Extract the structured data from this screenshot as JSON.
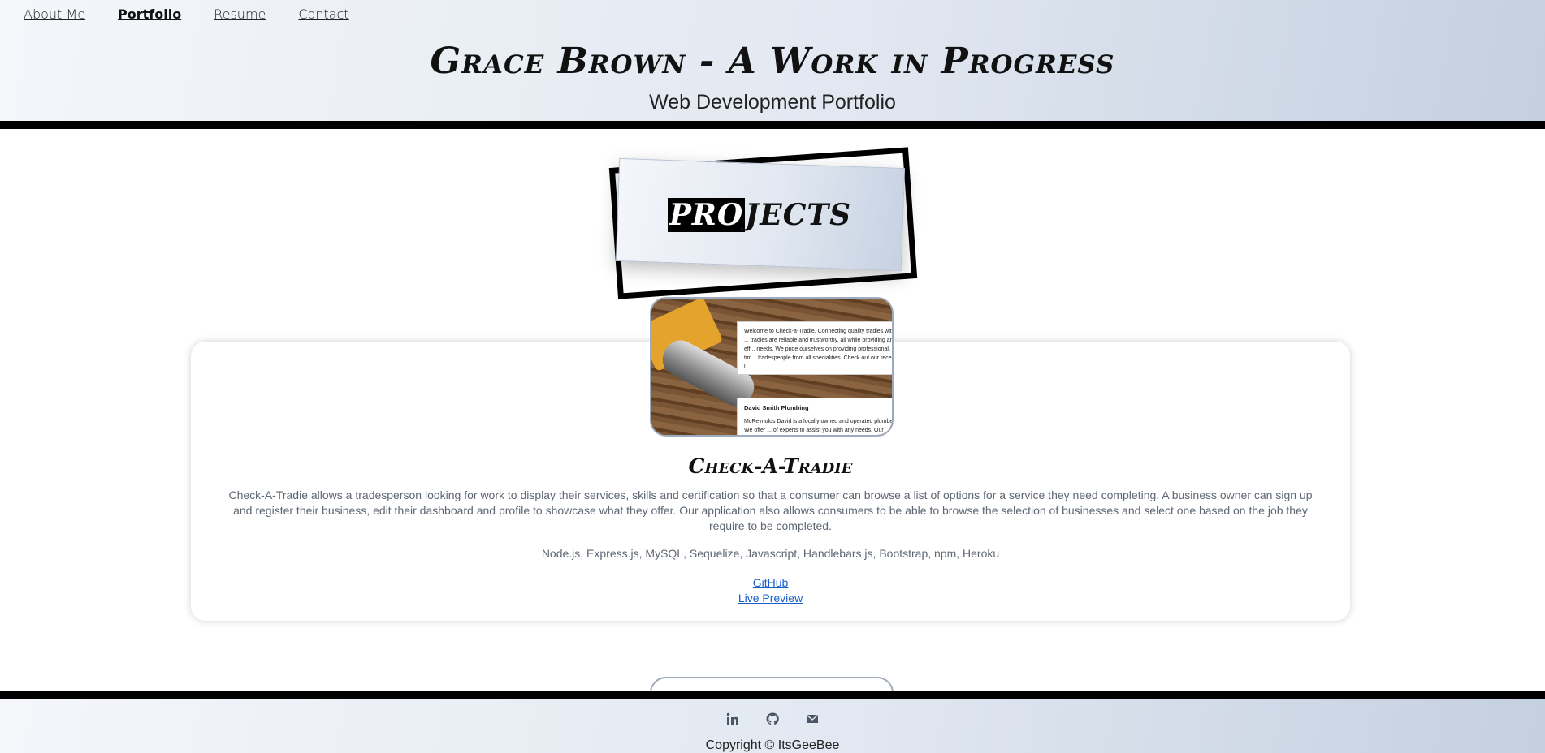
{
  "nav": {
    "items": [
      {
        "label": "About Me",
        "active": false
      },
      {
        "label": "Portfolio",
        "active": true
      },
      {
        "label": "Resume",
        "active": false
      },
      {
        "label": "Contact",
        "active": false
      }
    ]
  },
  "header": {
    "title": "Grace Brown - A Work in Progress",
    "subtitle": "Web Development Portfolio"
  },
  "projects_banner": {
    "highlight": "PRO",
    "rest": "JECTS"
  },
  "project": {
    "title": "Check-A-Tradie",
    "description": "Check-A-Tradie allows a tradesperson looking for work to display their services, skills and certification so that a consumer can browse a list of options for a service they need completing. A business owner can sign up and register their business, edit their dashboard and profile to showcase what they offer. Our application also allows consumers to be able to browse the selection of businesses and select one based on the job they require to be completed.",
    "tech": "Node.js, Express.js, MySQL, Sequelize, Javascript, Handlebars.js, Bootstrap, npm, Heroku",
    "github_label": "GitHub",
    "preview_label": "Live Preview",
    "screenshot": {
      "panel1": "Welcome to Check-a-Tradie. Connecting quality tradies with ... tradies are reliable and trustworthy, all while providing an eff... needs. We pride ourselves on providing professional, tim... tradespeople from all specialities. Check out our recent l...",
      "panel2_title": "David Smith Plumbing",
      "panel2_text": "McReynolds David is a locally owned and operated plumber. We offer ... of experts to assist you with any needs. Our service is flexible and by ..."
    }
  },
  "footer": {
    "icons": [
      "linkedin-icon",
      "github-icon",
      "email-icon"
    ],
    "copyright": "Copyright © ItsGeeBee"
  },
  "colors": {
    "header_gradient_start": "#f4f6fa",
    "header_gradient_end": "#c4cfe0",
    "link": "#1a5fc9",
    "rule": "#000000",
    "muted_text": "#5e6774"
  }
}
